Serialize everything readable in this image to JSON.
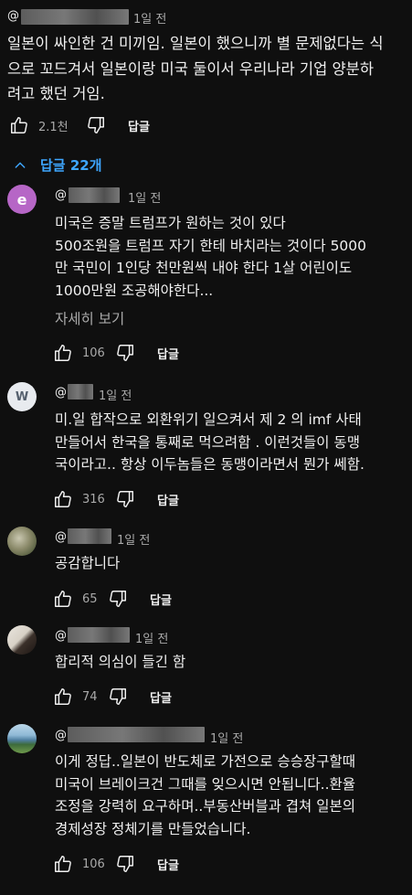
{
  "top_comment": {
    "handle": "@",
    "time": "1일 전",
    "text": "일본이 싸인한 건 미끼임. 일본이 했으니까 별 문제없다는 식\n으로 꼬드겨서 일본이랑 미국 둘이서 우리나라 기업 양분하\n려고 했던 거임.",
    "likes": "2.1천",
    "reply_label": "답글"
  },
  "replies_toggle": {
    "label": "답글 22개",
    "icon": "chevron-up-icon",
    "color": "#3ea6ff"
  },
  "replies": [
    {
      "handle": "@",
      "time": "1일 전",
      "text": "미국은 증말 트럼프가 원하는 것이 있다\n500조원을 트럼프 자기 한테 바치라는 것이다 5000\n만 국민이 1인당 천만원씩 내야 한다 1살 어린이도\n1000만원 조공해야한다...",
      "more": "자세히 보기",
      "likes": "106",
      "reply_label": "답글",
      "avatar": {
        "type": "letter",
        "letter": "e",
        "color": "#b666c6"
      }
    },
    {
      "handle": "@",
      "time": "1일 전",
      "text": "미.일 합작으로 외환위기 일으켜서 제 2 의 imf 사태\n만들어서 한국을 통째로 먹으려함 . 이런것들이 동맹\n국이라고.. 항상 이두놈들은 동맹이라면서 뭔가 쎄함.",
      "likes": "316",
      "reply_label": "답글",
      "avatar": {
        "type": "letter",
        "letter": "W",
        "color": "#e8ebef"
      }
    },
    {
      "handle": "@",
      "time": "1일 전",
      "text": "공감합니다",
      "likes": "65",
      "reply_label": "답글",
      "avatar": {
        "type": "photo"
      }
    },
    {
      "handle": "@",
      "time": "1일 전",
      "text": "합리적 의심이 들긴 함",
      "likes": "74",
      "reply_label": "답글",
      "avatar": {
        "type": "photo"
      }
    },
    {
      "handle": "@",
      "time": "1일 전",
      "text": "이게 정답..일본이 반도체로 가전으로 승승장구할때\n미국이 브레이크건 그때를 잊으시면 안됩니다..환율\n조정을 강력히 요구하며..부동산버블과 겹쳐 일본의\n경제성장 정체기를 만들었습니다.",
      "likes": "106",
      "reply_label": "답글",
      "avatar": {
        "type": "photo"
      }
    }
  ]
}
